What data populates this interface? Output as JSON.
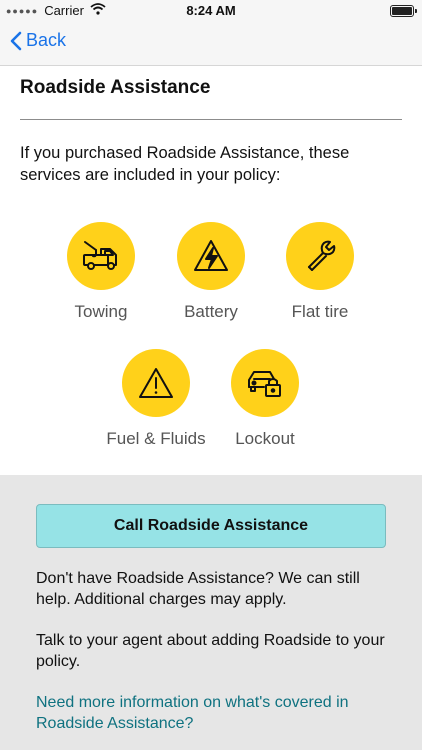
{
  "status_bar": {
    "carrier": "Carrier",
    "time": "8:24 AM"
  },
  "nav": {
    "back_label": "Back"
  },
  "page": {
    "title": "Roadside Assistance",
    "intro": "If you purchased Roadside Assistance, these services are included in your policy:"
  },
  "services": [
    {
      "label": "Towing",
      "icon": "tow-truck-icon"
    },
    {
      "label": "Battery",
      "icon": "battery-bolt-icon"
    },
    {
      "label": "Flat tire",
      "icon": "wrench-icon"
    },
    {
      "label": "Fuel & Fluids",
      "icon": "warning-icon"
    },
    {
      "label": "Lockout",
      "icon": "car-lock-icon"
    }
  ],
  "bottom": {
    "call_label": "Call Roadside Assistance",
    "no_roadside_text": "Don't have Roadside Assistance? We can still help. Additional charges may apply.",
    "agent_text": "Talk to your agent about adding Roadside to your policy.",
    "info_link": "Need more information on what's covered in Roadside Assistance?"
  },
  "colors": {
    "accent_yellow": "#ffd11a",
    "call_button": "#96e3e6",
    "link": "#0f7280",
    "back": "#1a73e8"
  }
}
